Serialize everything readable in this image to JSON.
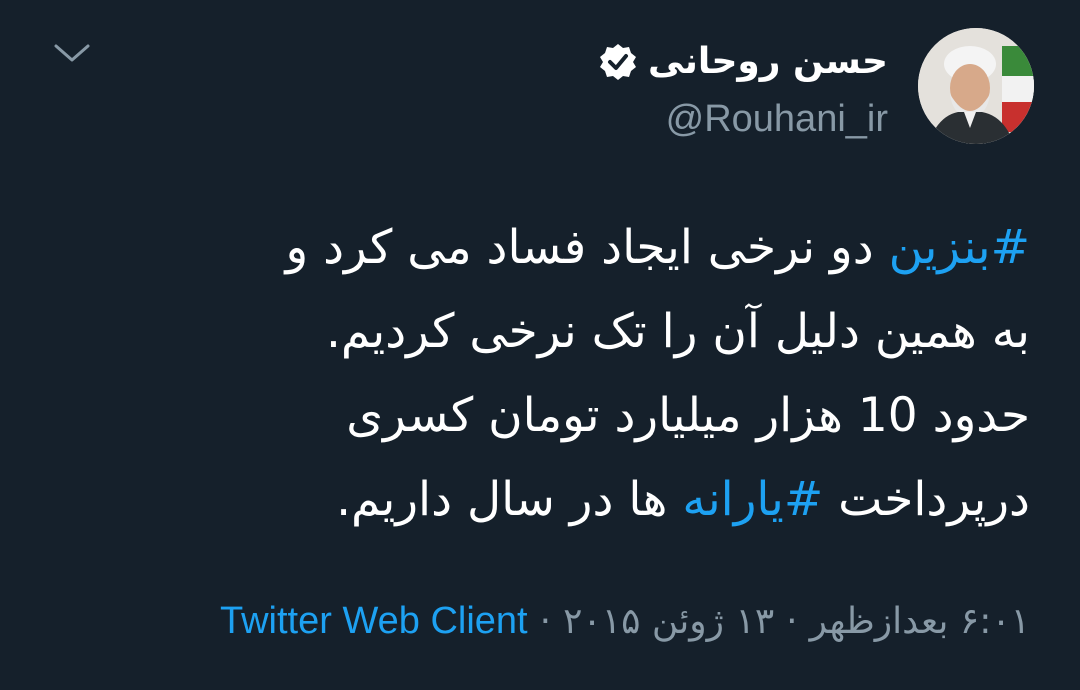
{
  "tweet": {
    "author": {
      "name": "حسن روحانی",
      "handle": "@Rouhani_ir",
      "verified": true
    },
    "text_lines": [
      {
        "hashtag": "#بنزین",
        "rest": " دو نرخی ایجاد فساد می کرد و"
      },
      {
        "text": "به همین دلیل آن را تک نرخی کردیم."
      },
      {
        "text": "حدود 10 هزار میلیارد تومان کسری"
      },
      {
        "before": "درپرداخت  ",
        "hashtag": "#یارانه",
        "after": " ها در سال داریم."
      }
    ],
    "meta": {
      "time": "۶:۰۱ بعدازظهر",
      "date": "۱۳ ژوئن ۲۰۱۵",
      "separator": "·",
      "client": "Twitter Web Client"
    }
  },
  "colors": {
    "background": "#15202b",
    "text": "#ffffff",
    "secondary": "#8899a6",
    "accent": "#1da1f2"
  },
  "icons": {
    "menu": "chevron-down-icon",
    "verified": "verified-badge-icon"
  }
}
